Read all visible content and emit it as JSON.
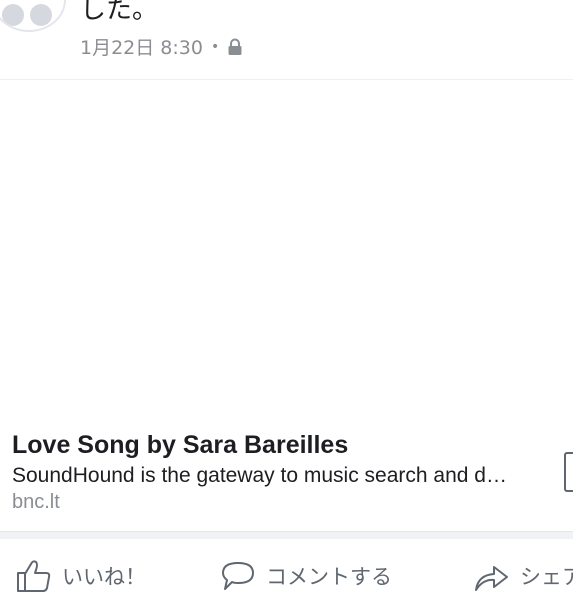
{
  "post": {
    "text": "した。",
    "date": "1月22日 8:30",
    "separator": "•",
    "privacy_icon": "lock-icon"
  },
  "link_preview": {
    "title": "Love Song by Sara Bareilles",
    "description": "SoundHound is the gateway to music search and d…",
    "domain": "bnc.lt"
  },
  "actions": {
    "like_label": "いいね！",
    "comment_label": "コメントする",
    "share_label": "シェア"
  },
  "colors": {
    "text": "#1c1e21",
    "secondary": "#8a8d91",
    "icon": "#606770",
    "divider": "#f0f2f5"
  }
}
